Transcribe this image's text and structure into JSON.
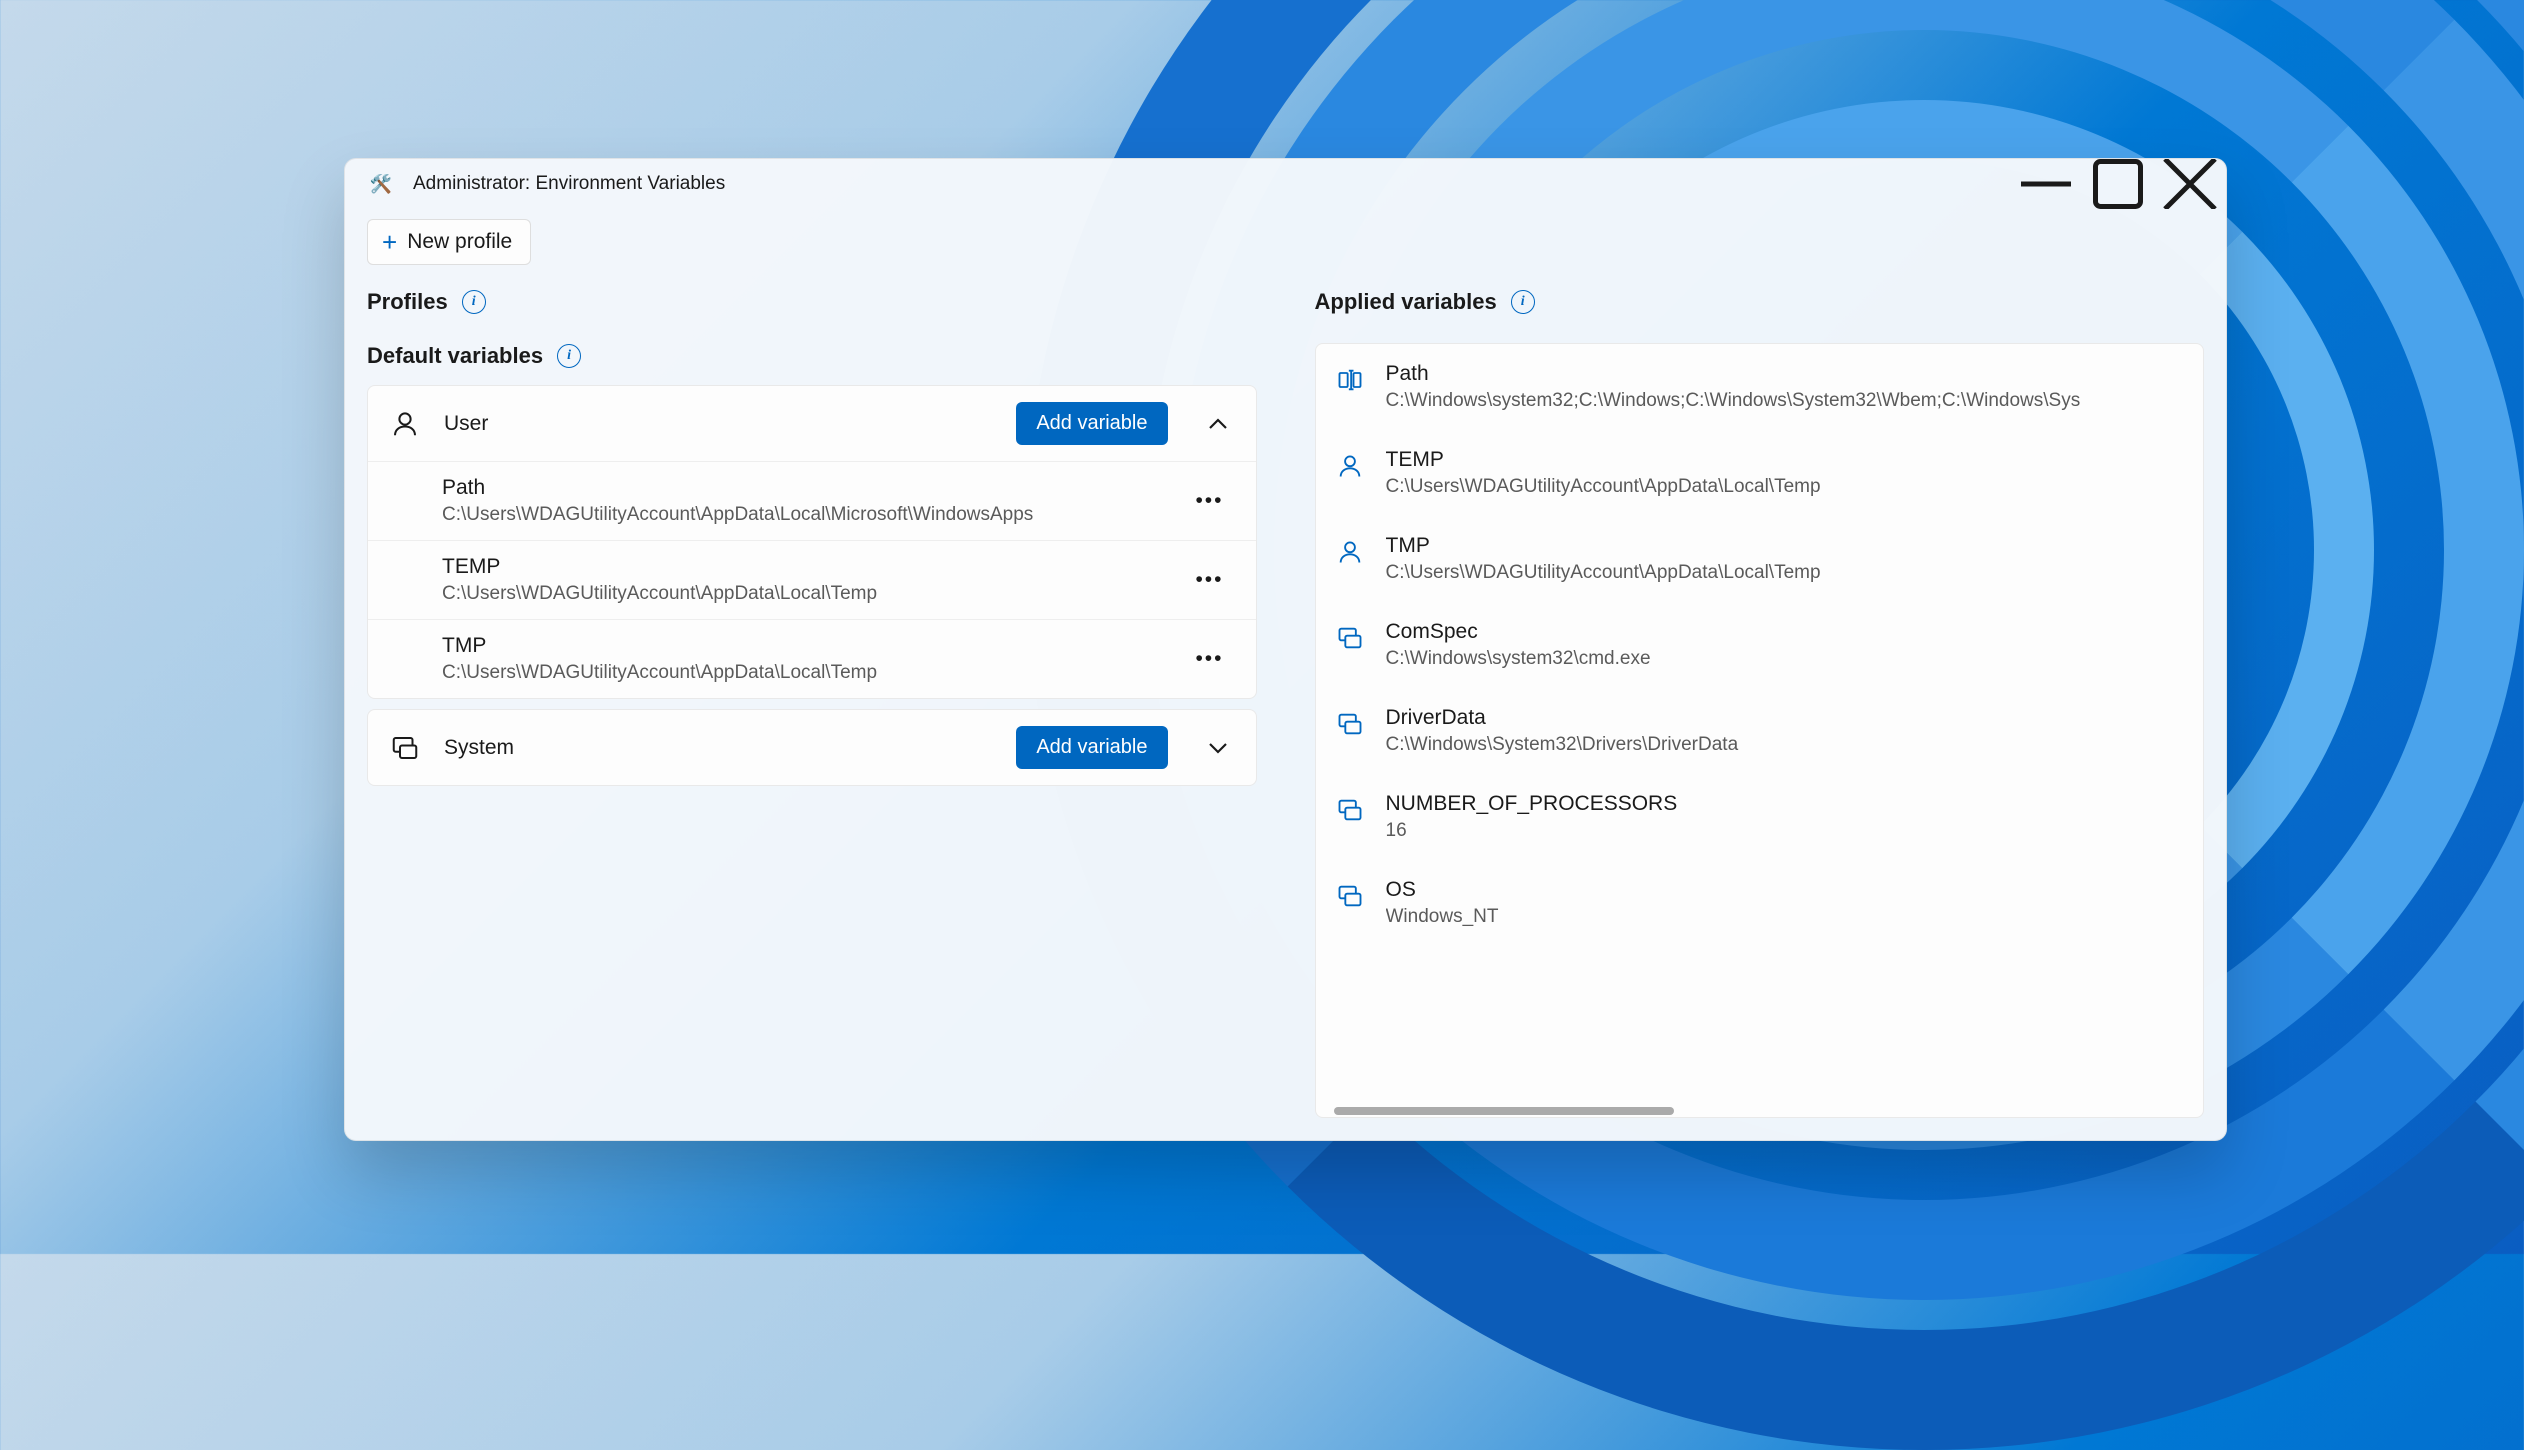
{
  "window": {
    "title": "Administrator: Environment Variables"
  },
  "toolbar": {
    "new_profile": "New profile"
  },
  "sections": {
    "profiles": "Profiles",
    "default_variables": "Default variables",
    "applied_variables": "Applied variables"
  },
  "groups": {
    "user": {
      "label": "User",
      "add": "Add variable",
      "vars": [
        {
          "name": "Path",
          "value": "C:\\Users\\WDAGUtilityAccount\\AppData\\Local\\Microsoft\\WindowsApps"
        },
        {
          "name": "TEMP",
          "value": "C:\\Users\\WDAGUtilityAccount\\AppData\\Local\\Temp"
        },
        {
          "name": "TMP",
          "value": "C:\\Users\\WDAGUtilityAccount\\AppData\\Local\\Temp"
        }
      ]
    },
    "system": {
      "label": "System",
      "add": "Add variable"
    }
  },
  "applied": [
    {
      "icon": "rename",
      "name": "Path",
      "value": "C:\\Windows\\system32;C:\\Windows;C:\\Windows\\System32\\Wbem;C:\\Windows\\Sys"
    },
    {
      "icon": "user",
      "name": "TEMP",
      "value": "C:\\Users\\WDAGUtilityAccount\\AppData\\Local\\Temp"
    },
    {
      "icon": "user",
      "name": "TMP",
      "value": "C:\\Users\\WDAGUtilityAccount\\AppData\\Local\\Temp"
    },
    {
      "icon": "system",
      "name": "ComSpec",
      "value": "C:\\Windows\\system32\\cmd.exe"
    },
    {
      "icon": "system",
      "name": "DriverData",
      "value": "C:\\Windows\\System32\\Drivers\\DriverData"
    },
    {
      "icon": "system",
      "name": "NUMBER_OF_PROCESSORS",
      "value": "16"
    },
    {
      "icon": "system",
      "name": "OS",
      "value": "Windows_NT"
    }
  ]
}
